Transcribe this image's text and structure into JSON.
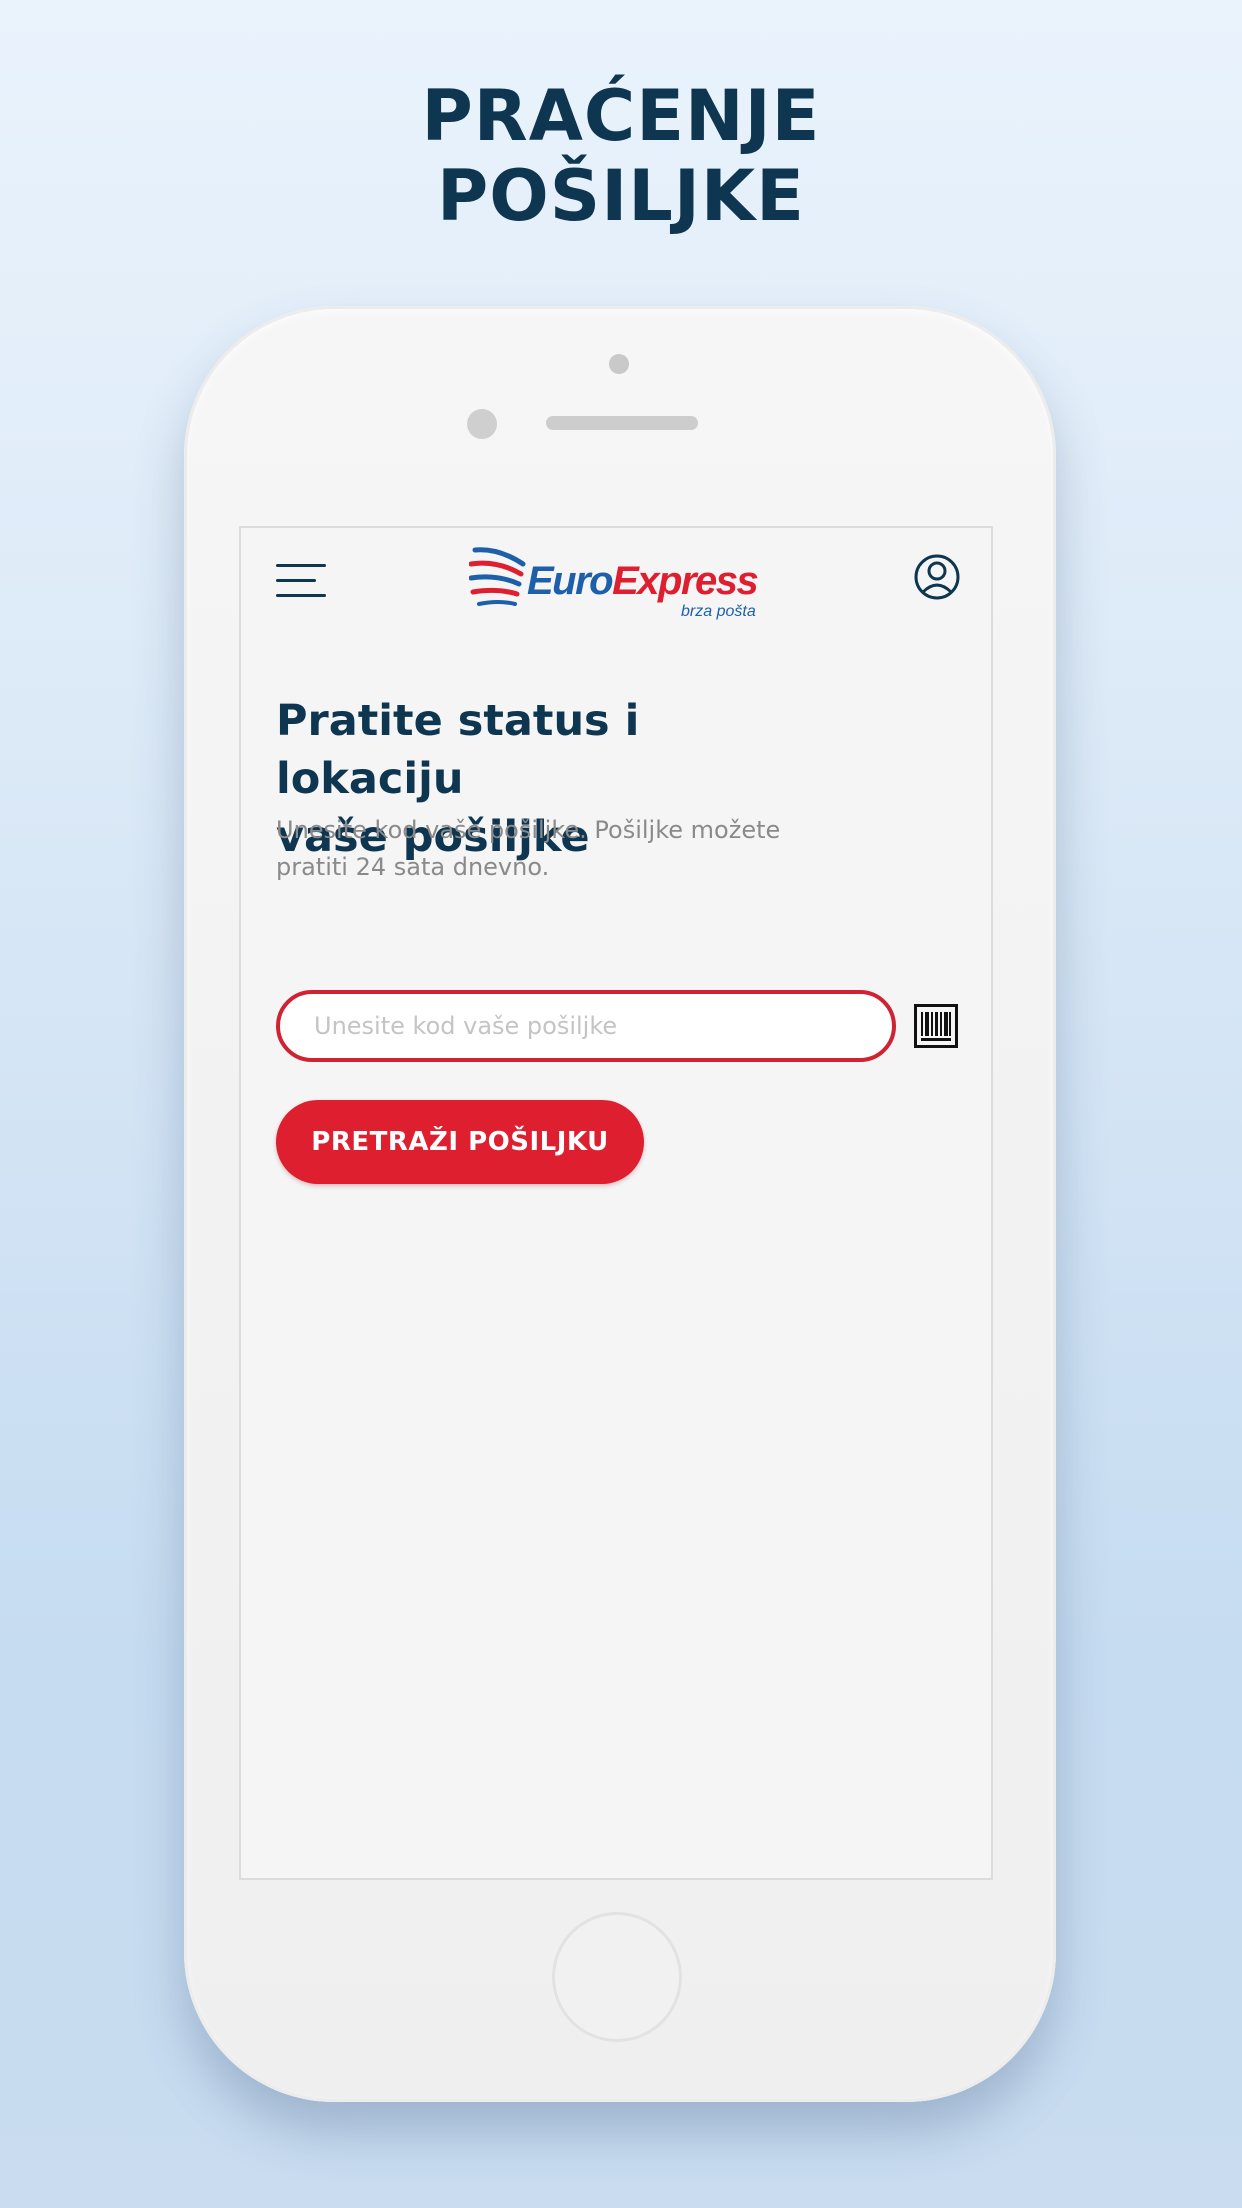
{
  "promo": {
    "title_line1": "PRAĆENJE",
    "title_line2": "POŠILJKE"
  },
  "header": {
    "logo_text_euro": "Euro",
    "logo_text_express": "Express",
    "logo_tagline": "brza pošta",
    "menu_icon": "hamburger-menu-icon",
    "user_icon": "user-account-icon"
  },
  "main": {
    "headline_line1": "Pratite status i lokaciju",
    "headline_line2": "vaše pošiljke",
    "subtitle_line1": "Unesite kod vaše pošiljke. Pošiljke možete",
    "subtitle_line2": "pratiti 24 sata dnevno.",
    "input_value": "",
    "input_placeholder": "Unesite kod vaše pošiljke",
    "barcode_icon": "barcode-scanner-icon",
    "search_button_label": "PRETRAŽI POŠILJKU"
  },
  "colors": {
    "brand_red": "#dd1f30",
    "brand_blue": "#0e3650",
    "logo_blue": "#1d5fa8",
    "background": "#f5f5f5"
  }
}
